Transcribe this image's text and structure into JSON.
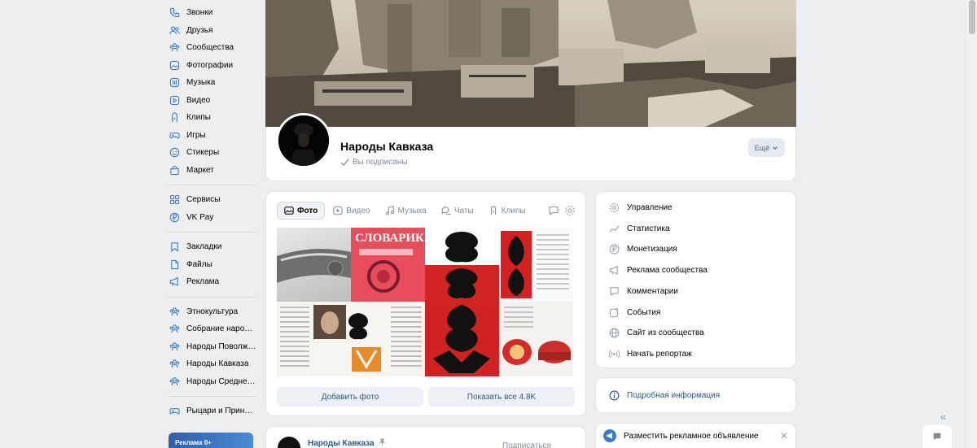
{
  "left_nav": {
    "group1": [
      {
        "label": "Звонки",
        "icon": "phone-icon"
      },
      {
        "label": "Друзья",
        "icon": "friends-icon"
      },
      {
        "label": "Сообщества",
        "icon": "communities-icon"
      },
      {
        "label": "Фотографии",
        "icon": "photos-icon"
      },
      {
        "label": "Музыка",
        "icon": "music-icon"
      },
      {
        "label": "Видео",
        "icon": "video-icon"
      },
      {
        "label": "Клипы",
        "icon": "clips-icon"
      },
      {
        "label": "Игры",
        "icon": "games-icon"
      },
      {
        "label": "Стикеры",
        "icon": "stickers-icon"
      },
      {
        "label": "Маркет",
        "icon": "market-icon"
      }
    ],
    "group2": [
      {
        "label": "Сервисы",
        "icon": "services-icon"
      },
      {
        "label": "VK Pay",
        "icon": "vkpay-icon"
      }
    ],
    "group3": [
      {
        "label": "Закладки",
        "icon": "bookmarks-icon"
      },
      {
        "label": "Файлы",
        "icon": "files-icon"
      },
      {
        "label": "Реклама",
        "icon": "ads-icon"
      }
    ],
    "group4": [
      {
        "label": "Этнокультура",
        "icon": "community-icon"
      },
      {
        "label": "Собрание народн...",
        "icon": "community-icon"
      },
      {
        "label": "Народы Поволжь...",
        "icon": "community-icon"
      },
      {
        "label": "Народы Кавказа",
        "icon": "community-icon"
      },
      {
        "label": "Народы Средней ...",
        "icon": "community-icon"
      }
    ],
    "group5": [
      {
        "label": "Рыцари и Принце...",
        "icon": "games-icon"
      }
    ],
    "ad_thumb_text": "Реклама 0+"
  },
  "header": {
    "group_name": "Народы Кавказа",
    "subscribed": "Вы подписаны",
    "more_label": "Ещё"
  },
  "media": {
    "tabs": [
      "Фото",
      "Видео",
      "Музыка",
      "Чаты",
      "Клипы"
    ],
    "active_tab": "Фото",
    "add_photo": "Добавить фото",
    "show_all": "Показать все 4.8K",
    "photo_texts": {
      "book_title": "СЛОВАРИК"
    }
  },
  "manage": {
    "items": [
      {
        "label": "Управление",
        "icon": "gear-icon"
      },
      {
        "label": "Статистика",
        "icon": "stats-icon"
      },
      {
        "label": "Монетизация",
        "icon": "ruble-icon"
      },
      {
        "label": "Реклама сообщества",
        "icon": "megaphone-icon"
      },
      {
        "label": "Комментарии",
        "icon": "comment-icon"
      },
      {
        "label": "События",
        "icon": "calendar-icon"
      },
      {
        "label": "Сайт из сообщества",
        "icon": "globe-icon"
      },
      {
        "label": "Начать репортаж",
        "icon": "broadcast-icon"
      }
    ]
  },
  "info": {
    "label": "Подробная информация"
  },
  "ad_card": {
    "label": "Разместить рекламное объявление"
  },
  "post": {
    "author": "Народы Кавказа",
    "extra": "Подписаться"
  },
  "colors": {
    "accent": "#2a5885",
    "nav_icon": "#3f7cc2",
    "page_bg": "#edeef0"
  }
}
